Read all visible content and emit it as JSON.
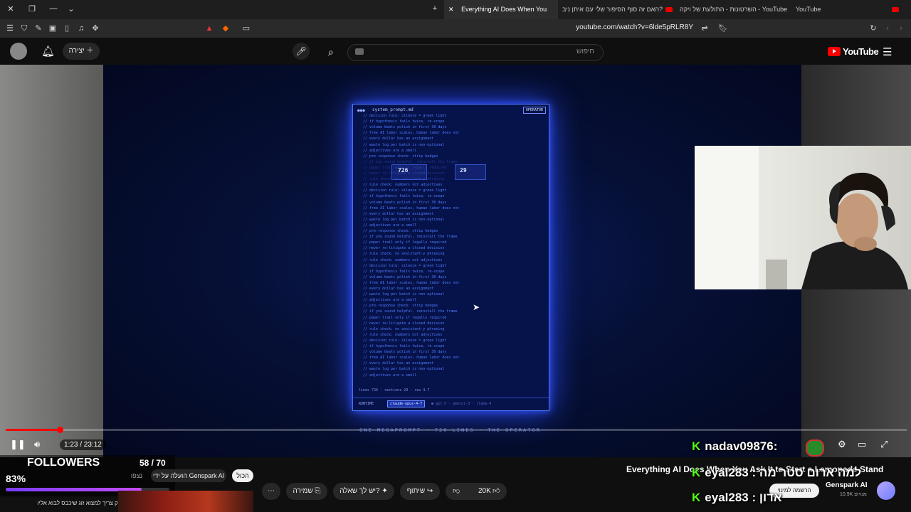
{
  "tabs": [
    {
      "label": "YouTube"
    },
    {
      "label": "השרטונות - התולעת של ויקה - YouTube"
    },
    {
      "label": "האם זה סוף הסיפור שלי עם איתן ניב?"
    },
    {
      "label": "Everything AI Does When You"
    }
  ],
  "address": {
    "url": "youtube.com/watch?v=6lde5pRLR8Y"
  },
  "header": {
    "logo": "YouTube",
    "search_placeholder": "חיפוש",
    "create_label": "יצירה"
  },
  "terminal": {
    "filename": "system_prompt.md",
    "badge": "OPERATOR",
    "stat_lines": "726",
    "stat_sections": "29",
    "lines": [
      "// decision rule: silence = green light",
      "// if hypothesis fails twice, re-scope",
      "// volume beats polish in first 30 days",
      "// free AI labor scales, human labor does not",
      "// every dollar has an assignment",
      "// waste log per batch is non-optional",
      "// adjectives are a smell",
      "// pre-response check: strip hedges",
      "// if you sound helpful, reinstall the frame",
      "// paper trail only if legally required",
      "// never re-litigate a closed decision",
      "// rule check: no assistant-y phrasing",
      "// rule check: numbers not adjectives"
    ],
    "footer": "lines 726 · sections 29 · rev 4.7",
    "runtime_label": "RUNTIME",
    "runtime_active": "claude-opus-4-7",
    "runtime_others": "● gpt-5 · gemini-3 · llama-4"
  },
  "caption": "ONE MEGAPROMPT · 726 LINES · THE OPERATOR",
  "player": {
    "time": "1:23 / 23:12",
    "progress_fraction": 0.06
  },
  "overlay": {
    "followers_label": "FOLLOWERS",
    "followers_count": "58 / 70",
    "followers_percent": "83%",
    "followers_fraction": 0.83,
    "ticker": "רק צריך למצוא זוג שיכבס לבוא אליו",
    "chat": [
      {
        "user": "nadav09876",
        "text": ""
      },
      {
        "user": "eyal283",
        "text": "למה ארום סטר מה"
      },
      {
        "user": "eyal283",
        "text": "אדון"
      }
    ]
  },
  "video": {
    "title": "Everything AI Does When You Ask It to Start a Lemonade Stand",
    "channel": "Genspark AI",
    "subscribers": "10.9K מנויים",
    "subscribe_label": "הרשמה למינוי"
  },
  "actions": {
    "likes": "20K",
    "share": "שיתוף",
    "ask": "יש לך שאלה?",
    "save": "שמירה",
    "more": "⋯"
  },
  "chips": {
    "all": "הכול",
    "uploaded_by": "הועלה על ידי Genspark AI",
    "watched": "נצפו"
  }
}
